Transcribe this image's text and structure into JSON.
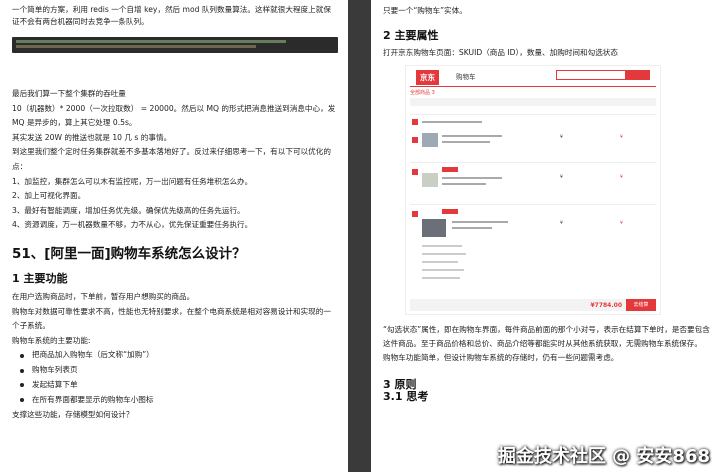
{
  "left": {
    "intro": "一个简单的方案，利用 redis 一个自增 key，然后 mod 队列数量算法。这样就很大程度上就保证不会有两台机器同时去竞争一条队列。",
    "throughput_title": "最后我们算一下整个集群的吞吐量",
    "calc": "10（机器数）* 2000（一次拉取数） = 20000。然后以 MQ 的形式把消息推送到消息中心，发 MQ 是异步的，算上其它处理 0.5s。",
    "result": "其实发送 20W 的推送也就是 10 几 s 的事情。",
    "review": "到这里我们整个定时任务集群就差不多基本落地好了。反过来仔细思考一下，有以下可以优化的点：",
    "points": [
      "1、加监控，集群怎么可以木有监控呢，万一出问题有任务堆积怎么办。",
      "2、加上可视化界面。",
      "3、最好有智能调度，增加任务优先级。确保优先级高的任务先运行。",
      "4、资源调度，万一机器数量不够，力不从心，优先保证重要任务执行。"
    ],
    "section_title": "51、[阿里一面]购物车系统怎么设计？",
    "sub_title": "1 主要功能",
    "func_desc": "在用户选购商品时，下单前，暂存用户想购买的商品。",
    "func_desc2": "购物车对数据可靠性要求不高，性能也无特别要求，在整个电商系统是相对容易设计和实现的一个子系统。",
    "main_funcs_label": "购物车系统的主要功能:",
    "funcs": [
      "把商品加入购物车（后文称“加购”）",
      "购物车列表页",
      "发起结算下单",
      "在所有界面都要显示的购物车小图标"
    ],
    "support": "支撑这些功能，存储模型如何设计？"
  },
  "right": {
    "top_line": "只要一个“购物车”实体。",
    "sub_title": "2 主要属性",
    "attrs": "打开京东购物车页面：SKUID（商品 ID），数量、加购时间和勾选状态",
    "jd": {
      "logo": "京东",
      "cart": "购物车",
      "all_goods": "全部商品 3",
      "total": "¥7784.00",
      "checkout": "去结算"
    },
    "check_desc": "“勾选状态”属性，即在购物车界面，每件商品前面的那个小对号，表示在结算下单时，是否要包含这件商品。至于商品价格和总价、商品介绍等都能实时从其他系统获取，无需购物车系统保存。",
    "simple": "购物车功能简单，但设计购物车系统的存储时，仍有一些问题需考虑。",
    "principles": "3 原则",
    "thinking": "3.1 思考",
    "watermark": "掘金技术社区 @ 安安868"
  }
}
